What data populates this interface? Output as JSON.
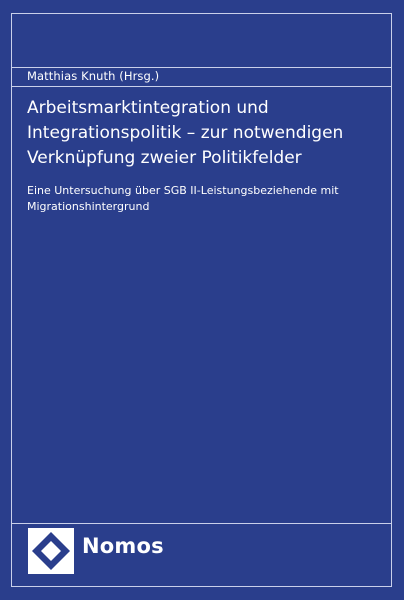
{
  "cover": {
    "author": "Matthias Knuth (Hrsg.)",
    "title_lines": [
      "Arbeitsmarktintegration und",
      "Integrationspolitik – zur notwendigen",
      "Verknüpfung zweier Politikfelder"
    ],
    "subtitle_lines": [
      "Eine Untersuchung über SGB II-Leistungsbeziehende mit",
      "Migrationshintergrund"
    ],
    "publisher": "Nomos",
    "logo_icon": "nomos-diamond-logo-icon"
  },
  "colors": {
    "background": "#2a3e8c",
    "frame_lines": "#c9d0ea",
    "text": "#ffffff"
  }
}
